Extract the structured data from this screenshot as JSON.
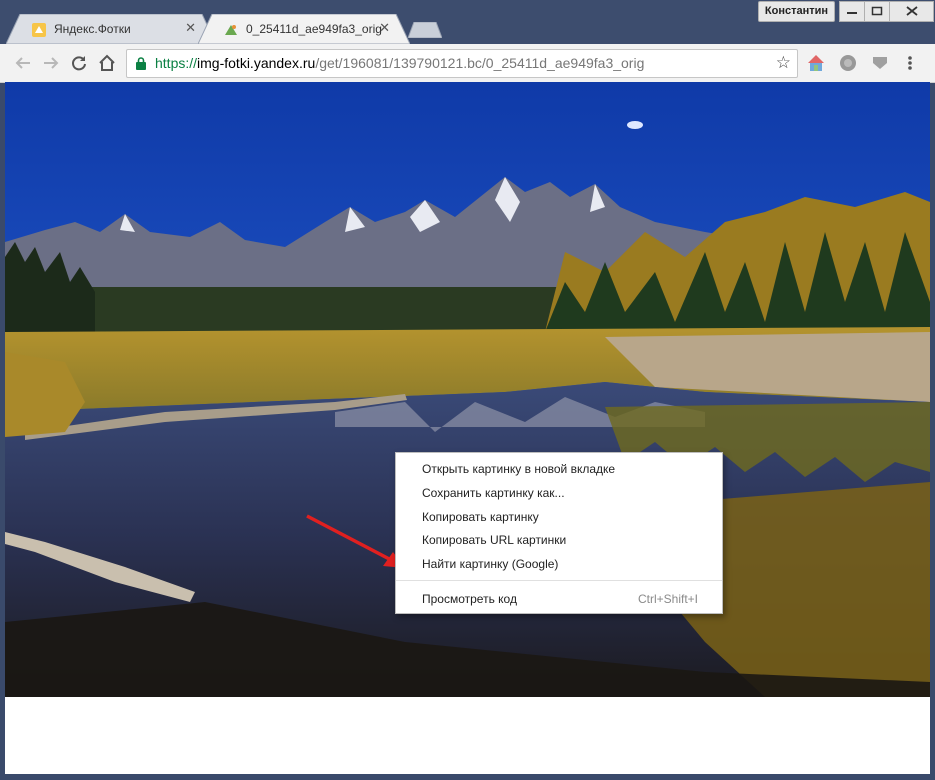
{
  "browser": {
    "tabs": [
      {
        "title": "Яндекс.Фотки",
        "favicon": "yandex-fotki-icon",
        "active": false
      },
      {
        "title": "0_25411d_ae949fa3_orig",
        "favicon": "image-icon",
        "active": true
      }
    ],
    "user_name": "Константин",
    "url": {
      "scheme": "https://",
      "host": "img-fotki.yandex.ru",
      "path": "/get/196081/139790121.bc/0_25411d_ae949fa3_orig"
    }
  },
  "context_menu": {
    "items": [
      {
        "label": "Открыть картинку в новой вкладке"
      },
      {
        "label": "Сохранить картинку как..."
      },
      {
        "label": "Копировать картинку"
      },
      {
        "label": "Копировать URL картинки"
      },
      {
        "label": "Найти картинку (Google)"
      }
    ],
    "inspect": {
      "label": "Просмотреть код",
      "shortcut": "Ctrl+Shift+I"
    }
  },
  "colors": {
    "annotation_arrow": "#e02020",
    "url_scheme": "#0b8043",
    "sky": "#1a45b8"
  }
}
